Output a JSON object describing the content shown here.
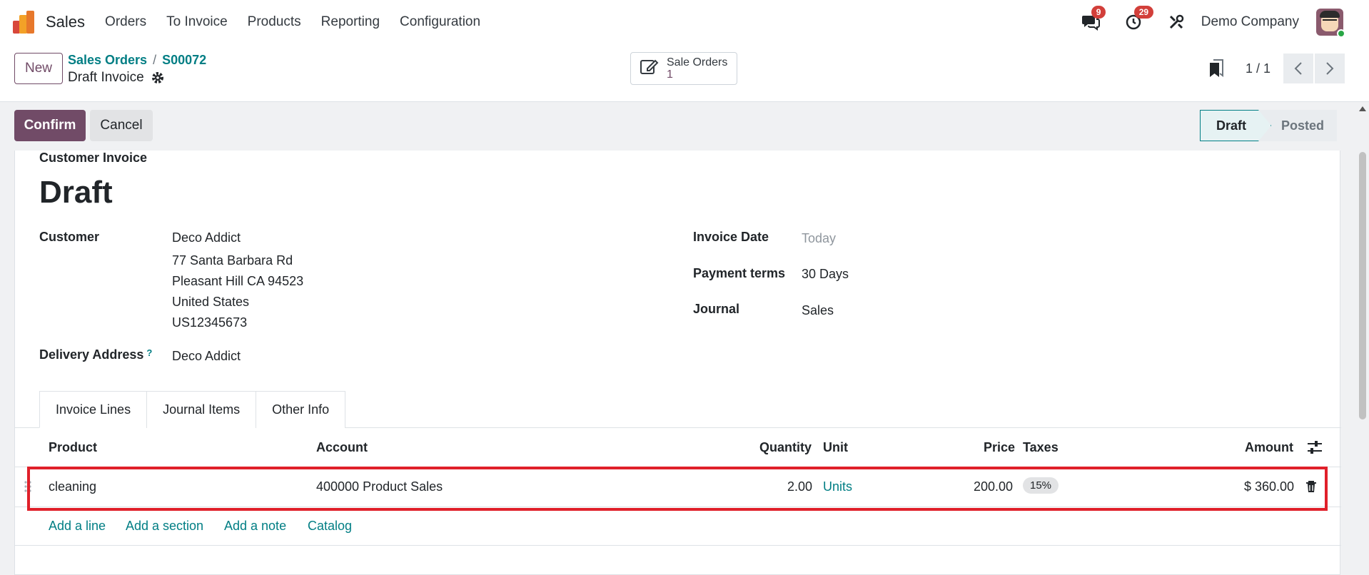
{
  "navbar": {
    "app_name": "Sales",
    "menu": [
      "Orders",
      "To Invoice",
      "Products",
      "Reporting",
      "Configuration"
    ],
    "messages_count": "9",
    "activities_count": "29",
    "company": "Demo Company"
  },
  "control": {
    "new_label": "New",
    "breadcrumb_parent": "Sales Orders",
    "breadcrumb_current": "S00072",
    "record_title": "Draft Invoice",
    "smart_button_label": "Sale Orders",
    "smart_button_value": "1",
    "pager": "1 / 1"
  },
  "actions": {
    "confirm_label": "Confirm",
    "cancel_label": "Cancel"
  },
  "status": {
    "stages": [
      "Draft",
      "Posted"
    ],
    "current": "Draft"
  },
  "form": {
    "doc_type": "Customer Invoice",
    "title": "Draft",
    "customer_label": "Customer",
    "customer_address": [
      "Deco Addict",
      "77 Santa Barbara Rd",
      "Pleasant Hill CA 94523",
      "United States",
      "US12345673"
    ],
    "delivery_label": "Delivery Address",
    "delivery_help": "?",
    "delivery_value": "Deco Addict",
    "invoice_date_label": "Invoice Date",
    "invoice_date_placeholder": "Today",
    "payment_terms_label": "Payment terms",
    "payment_terms_value": "30 Days",
    "journal_label": "Journal",
    "journal_value": "Sales"
  },
  "tabs": [
    "Invoice Lines",
    "Journal Items",
    "Other Info"
  ],
  "lines": {
    "headers": {
      "product": "Product",
      "account": "Account",
      "quantity": "Quantity",
      "unit": "Unit",
      "price": "Price",
      "taxes": "Taxes",
      "amount": "Amount"
    },
    "rows": [
      {
        "product": "cleaning",
        "account": "400000 Product Sales",
        "quantity": "2.00",
        "unit": "Units",
        "price": "200.00",
        "taxes": "15%",
        "amount": "$ 360.00"
      }
    ],
    "add_links": [
      "Add a line",
      "Add a section",
      "Add a note",
      "Catalog"
    ]
  },
  "colors": {
    "brand": "#714b67",
    "link": "#017e84",
    "highlight": "#e0202a"
  }
}
